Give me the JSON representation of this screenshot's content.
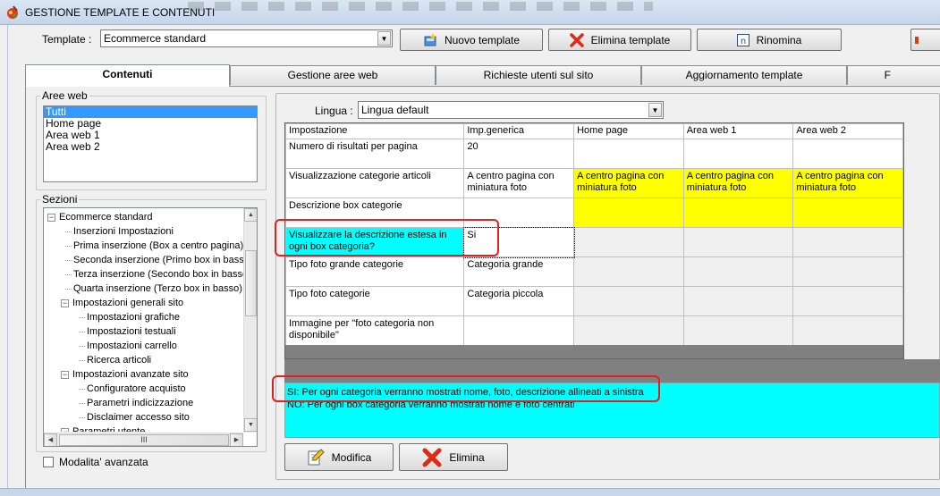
{
  "window": {
    "title": "GESTIONE TEMPLATE E CONTENUTI"
  },
  "template_row": {
    "label": "Template :",
    "selected": "Ecommerce standard",
    "buttons": {
      "new": "Nuovo template",
      "delete": "Elimina template",
      "rename": "Rinomina"
    }
  },
  "tabs": [
    {
      "label": "Contenuti",
      "active": true
    },
    {
      "label": "Gestione aree web",
      "active": false
    },
    {
      "label": "Richieste utenti sul sito",
      "active": false
    },
    {
      "label": "Aggiornamento template",
      "active": false
    },
    {
      "label": "F",
      "active": false
    }
  ],
  "aree_web": {
    "title": "Aree web",
    "items": [
      "Tutti",
      "Home page",
      "Area web 1",
      "Area web 2"
    ],
    "selected_index": 0
  },
  "sezioni": {
    "title": "Sezioni",
    "items": [
      {
        "label": "Ecommerce standard",
        "level": 0,
        "toggle": "-"
      },
      {
        "label": "Inserzioni Impostazioni",
        "level": 1
      },
      {
        "label": "Prima inserzione (Box a centro pagina)",
        "level": 1
      },
      {
        "label": "Seconda inserzione (Primo box in basso)",
        "level": 1
      },
      {
        "label": "Terza inserzione (Secondo box in basso)",
        "level": 1
      },
      {
        "label": "Quarta inserzione (Terzo box in basso)",
        "level": 1
      },
      {
        "label": "Impostazioni generali sito",
        "level": 1,
        "toggle": "-"
      },
      {
        "label": "Impostazioni grafiche",
        "level": 2
      },
      {
        "label": "Impostazioni testuali",
        "level": 2
      },
      {
        "label": "Impostazioni carrello",
        "level": 2
      },
      {
        "label": "Ricerca articoli",
        "level": 2
      },
      {
        "label": "Impostazioni avanzate sito",
        "level": 1,
        "toggle": "-"
      },
      {
        "label": "Configuratore acquisto",
        "level": 2
      },
      {
        "label": "Parametri indicizzazione",
        "level": 2
      },
      {
        "label": "Disclaimer accesso sito",
        "level": 2
      },
      {
        "label": "Parametri utente",
        "level": 1,
        "toggle": "-"
      }
    ]
  },
  "advanced_mode": {
    "label": "Modalita' avanzata",
    "checked": false
  },
  "lingua": {
    "label": "Lingua :",
    "selected": "Lingua default"
  },
  "grid": {
    "columns": [
      "Impostazione",
      "Imp.generica",
      "Home page",
      "Area web 1",
      "Area web 2"
    ],
    "rows": [
      {
        "cells": [
          "Numero di risultati per pagina",
          "20",
          "",
          "",
          ""
        ],
        "style": [
          "",
          "",
          "",
          "",
          ""
        ]
      },
      {
        "cells": [
          "Visualizzazione categorie articoli",
          "A centro pagina con miniatura foto",
          "A centro pagina con miniatura foto",
          "A centro pagina con miniatura foto",
          "A centro pagina con miniatura foto"
        ],
        "style": [
          "",
          "",
          "yel",
          "yel",
          "yel"
        ]
      },
      {
        "cells": [
          "Descrizione box categorie",
          "",
          "",
          "",
          ""
        ],
        "style": [
          "",
          "",
          "yel",
          "yel",
          "yel"
        ]
      },
      {
        "cells": [
          "Visualizzare la descrizione estesa in ogni box categoria?",
          "Si",
          "",
          "",
          ""
        ],
        "style": [
          "cyan",
          "",
          "gray",
          "gray",
          "gray"
        ]
      },
      {
        "cells": [
          "Tipo foto grande categorie",
          "Categoria grande",
          "",
          "",
          ""
        ],
        "style": [
          "",
          "",
          "gray",
          "gray",
          "gray"
        ]
      },
      {
        "cells": [
          "Tipo foto categorie",
          "Categoria piccola",
          "",
          "",
          ""
        ],
        "style": [
          "",
          "",
          "gray",
          "gray",
          "gray"
        ]
      },
      {
        "cells": [
          "Immagine per \"foto categoria non disponibile\"",
          "",
          "",
          "",
          ""
        ],
        "style": [
          "",
          "",
          "gray",
          "gray",
          "gray"
        ]
      },
      {
        "cells": [
          "",
          "",
          "",
          "",
          ""
        ],
        "style": [
          "gray",
          "gray",
          "gray",
          "gray",
          "gray"
        ]
      }
    ]
  },
  "description": {
    "lines": [
      "SI: Per ogni categoria verranno mostrati nome, foto, descrizione allineati a sinistra",
      "NO: Per ogni box categoria verranno mostrati nome e foto centrati"
    ]
  },
  "actions": {
    "modify": "Modifica",
    "delete": "Elimina"
  },
  "colors": {
    "highlight_yellow": "#ffff00",
    "highlight_cyan": "#00ffff",
    "annotation_red": "#e61e1e"
  }
}
